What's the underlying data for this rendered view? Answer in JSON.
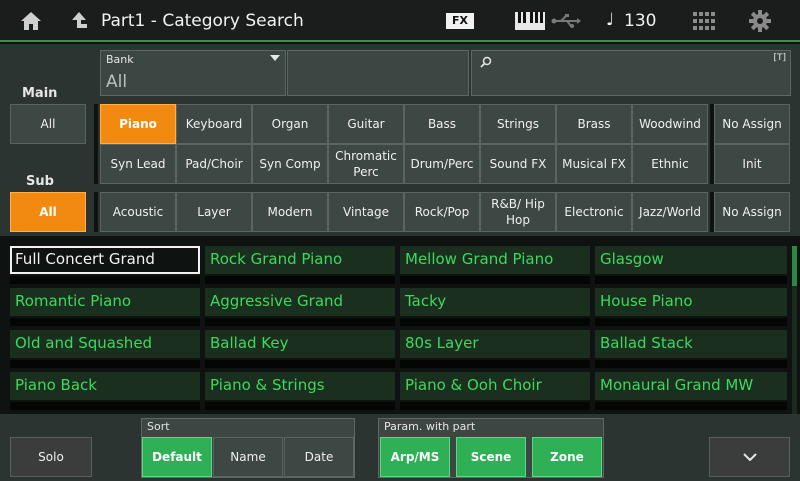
{
  "header": {
    "title": "Part1 - Category Search",
    "fx_label": "FX",
    "note_symbol": "♩",
    "tempo": "130"
  },
  "bank": {
    "label": "Bank",
    "value": "All"
  },
  "search": {
    "badge": "[T]",
    "value": ""
  },
  "labels": {
    "main": "Main",
    "sub": "Sub"
  },
  "main": {
    "all": "All",
    "row1": [
      "Piano",
      "Keyboard",
      "Organ",
      "Guitar",
      "Bass",
      "Strings",
      "Brass",
      "Woodwind"
    ],
    "row2": [
      "Syn Lead",
      "Pad/Choir",
      "Syn Comp",
      "Chromatic Perc",
      "Drum/Perc",
      "Sound FX",
      "Musical FX",
      "Ethnic"
    ],
    "no_assign": "No Assign",
    "init": "Init",
    "selected": "Piano"
  },
  "sub": {
    "all": "All",
    "items": [
      "Acoustic",
      "Layer",
      "Modern",
      "Vintage",
      "Rock/Pop",
      "R&B/ Hip Hop",
      "Electronic",
      "Jazz/World"
    ],
    "no_assign": "No Assign",
    "selected": "All"
  },
  "results": [
    [
      "Full Concert Grand",
      "Rock Grand Piano",
      "Mellow Grand Piano",
      "Glasgow"
    ],
    [
      "Romantic Piano",
      "Aggressive Grand",
      "Tacky",
      "House Piano"
    ],
    [
      "Old and Squashed",
      "Ballad Key",
      "80s Layer",
      "Ballad Stack"
    ],
    [
      "Piano Back",
      "Piano & Strings",
      "Piano & Ooh Choir",
      "Monaural Grand MW"
    ]
  ],
  "selected_result": "Full Concert Grand",
  "bottom": {
    "solo": "Solo",
    "sort_label": "Sort",
    "sort_options": [
      "Default",
      "Name",
      "Date"
    ],
    "sort_selected": "Default",
    "param_label": "Param. with part",
    "param_options": [
      "Arp/MS",
      "Scene",
      "Zone"
    ]
  },
  "colors": {
    "accent_orange": "#f28a12",
    "accent_green": "#2fb057",
    "result_text": "#3ed85e"
  },
  "icons": {
    "home": "home-icon",
    "up": "up-arrow-icon",
    "keyboard": "keyboard-icon",
    "usb": "usb-icon",
    "grid": "grid-icon",
    "gear": "gear-icon",
    "search": "search-icon",
    "chevron": "chevron-down-icon"
  }
}
